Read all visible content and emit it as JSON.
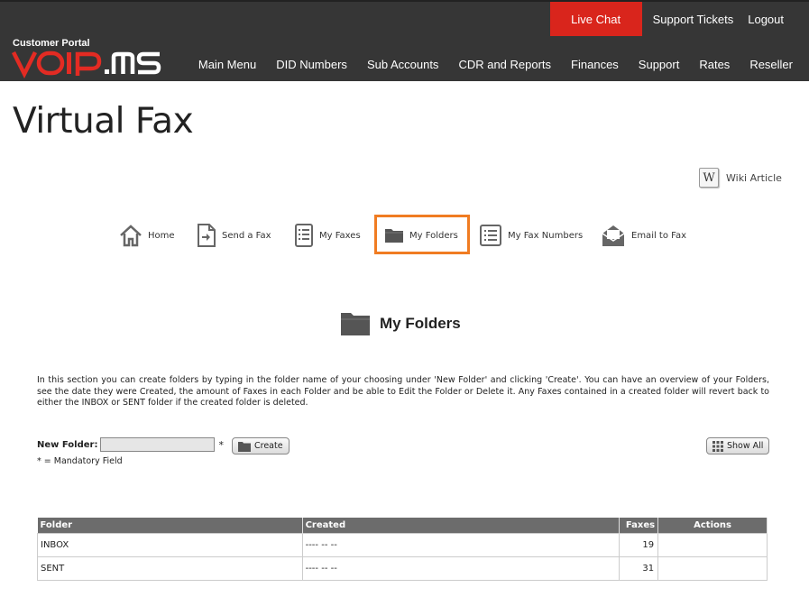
{
  "header": {
    "portal_label": "Customer Portal",
    "logo_text": "VOIP.MS",
    "top_links": {
      "live_chat": "Live Chat",
      "support_tickets": "Support Tickets",
      "logout": "Logout"
    },
    "nav": [
      "Main Menu",
      "DID Numbers",
      "Sub Accounts",
      "CDR and Reports",
      "Finances",
      "Support",
      "Rates",
      "Reseller"
    ],
    "colors": {
      "bar": "#363636",
      "accent": "#d9251c"
    }
  },
  "page": {
    "title": "Virtual Fax"
  },
  "wiki": {
    "icon": "W",
    "label": "Wiki Article"
  },
  "fax_nav": [
    {
      "label": "Home",
      "icon": "home-icon"
    },
    {
      "label": "Send a Fax",
      "icon": "send-fax-icon"
    },
    {
      "label": "My Faxes",
      "icon": "list-icon"
    },
    {
      "label": "My Folders",
      "icon": "folder-icon",
      "active": true
    },
    {
      "label": "My Fax Numbers",
      "icon": "list-icon"
    },
    {
      "label": "Email to Fax",
      "icon": "envelope-icon"
    }
  ],
  "section": {
    "title": "My Folders",
    "description": "In this section you can create folders by typing in the folder name of your choosing under 'New Folder' and clicking 'Create'. You can have an overview of your Folders, see the date they were Created, the amount of Faxes in each Folder and be able to Edit the Folder or Delete it. Any Faxes contained in a created folder will revert back to either the INBOX or SENT folder if the created folder is deleted."
  },
  "form": {
    "new_folder_label": "New Folder:",
    "new_folder_value": "",
    "required_mark": "*",
    "create_label": "Create",
    "show_all_label": "Show All",
    "mandatory_note": "* = Mandatory Field"
  },
  "table": {
    "headers": {
      "folder": "Folder",
      "created": "Created",
      "faxes": "Faxes",
      "actions": "Actions"
    },
    "rows": [
      {
        "folder": "INBOX",
        "created": "---- -- --",
        "faxes": "19",
        "actions": ""
      },
      {
        "folder": "SENT",
        "created": "---- -- --",
        "faxes": "31",
        "actions": ""
      }
    ]
  },
  "accent_active": "#f07c22"
}
